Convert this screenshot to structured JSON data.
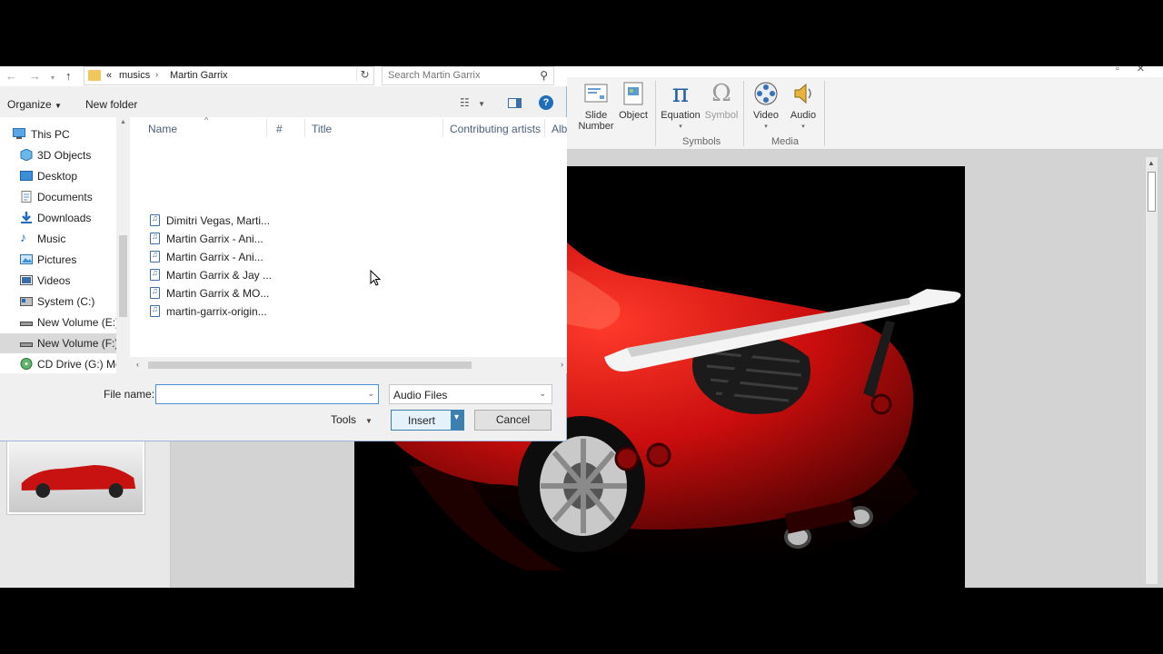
{
  "ribbon": {
    "buttons": [
      {
        "label": "Slide\nNumber",
        "line1": "Slide",
        "line2": "Number"
      },
      {
        "label": "Object"
      },
      {
        "label": "Equation"
      },
      {
        "label": "Symbol"
      },
      {
        "label": "Video"
      },
      {
        "label": "Audio"
      }
    ],
    "groups": {
      "symbols": "Symbols",
      "media": "Media"
    }
  },
  "dialog": {
    "breadcrumb": {
      "prefix": "«",
      "parent": "musics",
      "current": "Martin Garrix"
    },
    "search_placeholder": "Search Martin Garrix",
    "toolbar": {
      "organize": "Organize",
      "new_folder": "New folder"
    },
    "nav_items": [
      {
        "label": "This PC",
        "icon": "computer-icon"
      },
      {
        "label": "3D Objects",
        "icon": "cube-icon"
      },
      {
        "label": "Desktop",
        "icon": "desktop-icon"
      },
      {
        "label": "Documents",
        "icon": "documents-icon"
      },
      {
        "label": "Downloads",
        "icon": "download-icon"
      },
      {
        "label": "Music",
        "icon": "music-icon"
      },
      {
        "label": "Pictures",
        "icon": "pictures-icon"
      },
      {
        "label": "Videos",
        "icon": "videos-icon"
      },
      {
        "label": "System (C:)",
        "icon": "drive-icon"
      },
      {
        "label": "New Volume (E:)",
        "icon": "drive-icon"
      },
      {
        "label": "New Volume (F:)",
        "icon": "drive-icon"
      },
      {
        "label": "CD Drive (G:) Mol",
        "icon": "cd-drive-icon"
      }
    ],
    "columns": [
      "Name",
      "#",
      "Title",
      "Contributing artists",
      "Albu"
    ],
    "files": [
      "Dimitri Vegas, Marti...",
      "Martin Garrix - Ani...",
      "Martin Garrix - Ani...",
      "Martin Garrix & Jay ...",
      "Martin Garrix & MO...",
      "martin-garrix-origin..."
    ],
    "file_name_label": "File name:",
    "file_name_value": "",
    "file_type": "Audio Files",
    "tools_label": "Tools",
    "insert_label": "Insert",
    "cancel_label": "Cancel"
  },
  "colors": {
    "accent": "#1f6dbb",
    "ribbon_bg": "#f3f3f3",
    "car_red": "#d01010",
    "dialog_bg": "#f0f0f0"
  }
}
